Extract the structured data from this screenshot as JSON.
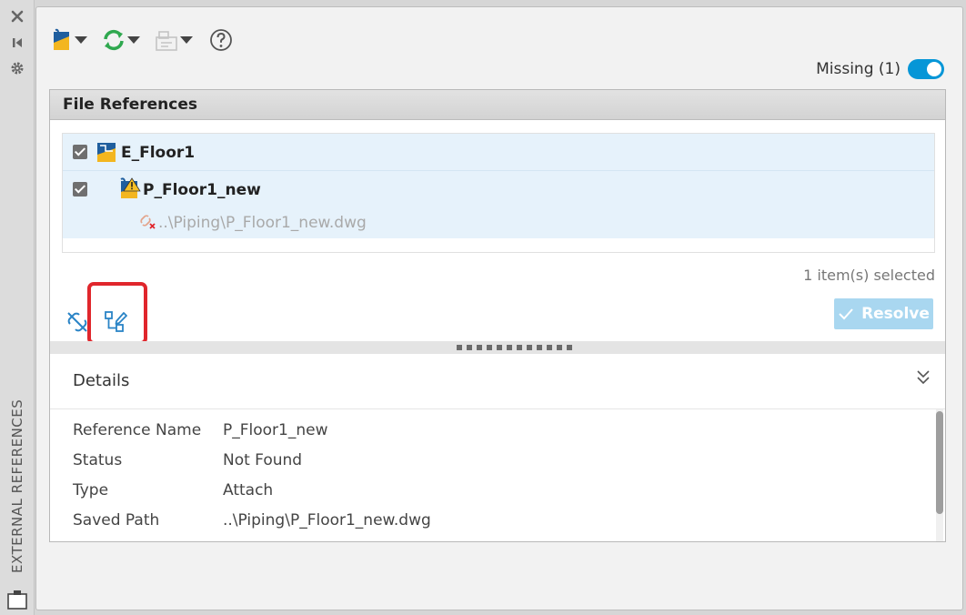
{
  "side": {
    "title": "EXTERNAL REFERENCES",
    "close_icon": "close-icon",
    "autohide_icon": "autohide-icon",
    "settings_icon": "gear-icon"
  },
  "toolbar": {
    "attach_icon": "attach-dwg-icon",
    "refresh_icon": "refresh-icon",
    "change_path_icon": "change-path-icon",
    "help_icon": "help-icon"
  },
  "filter": {
    "label": "Missing (1)",
    "enabled": true,
    "accent": "#0696d7"
  },
  "file_references": {
    "title": "File References",
    "items": [
      {
        "name": "E_Floor1",
        "checked": true
      },
      {
        "name": "P_Floor1_new",
        "checked": true,
        "path": "..\\Piping\\P_Floor1_new.dwg"
      }
    ],
    "selection_status": "1 item(s) selected",
    "resolve_label": "Resolve"
  },
  "details": {
    "title": "Details",
    "rows": [
      {
        "key": "Reference Name",
        "value": "P_Floor1_new"
      },
      {
        "key": "Status",
        "value": "Not Found"
      },
      {
        "key": "Type",
        "value": "Attach"
      },
      {
        "key": "Saved Path",
        "value": "..\\Piping\\P_Floor1_new.dwg"
      }
    ]
  },
  "colors": {
    "highlight": "#e0262c",
    "selection": "#e6f2fb",
    "resolve_disabled": "#a9d7f0"
  }
}
